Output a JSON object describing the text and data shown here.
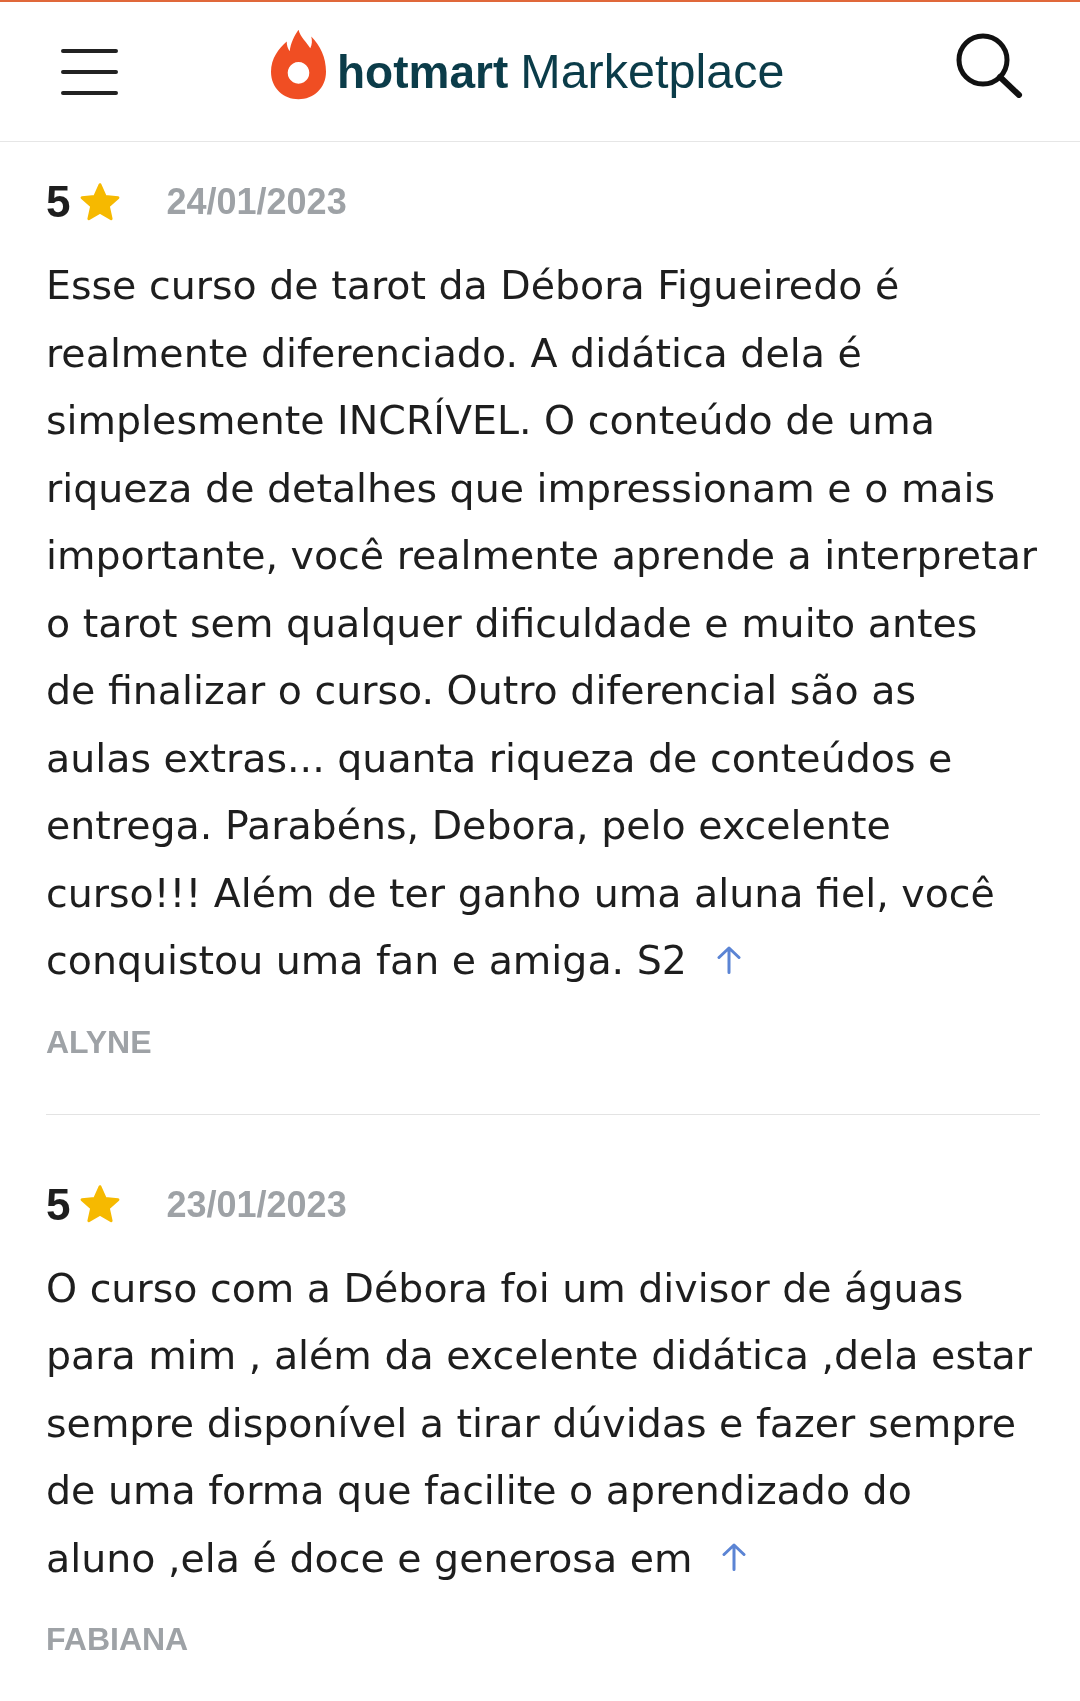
{
  "header": {
    "brand": "hotmart",
    "product": "Marketplace"
  },
  "reviews": [
    {
      "rating": "5",
      "date": "24/01/2023",
      "text": "Esse curso de tarot da Débora Figueiredo é\nrealmente diferenciado. A didática dela é\nsimplesmente INCRÍVEL. O conteúdo de uma\nriqueza de detalhes que impressionam e o mais\nimportante, você realmente aprende a interpretar\no tarot sem qualquer dificuldade e muito antes\nde finalizar o curso. Outro diferencial são as\naulas extras... quanta riqueza de conteúdos e\nentrega. Parabéns, Debora, pelo excelente\ncurso!!! Além de ter ganho uma aluna fiel, você\nconquistou uma fan e amiga. S2",
      "author": "ALYNE"
    },
    {
      "rating": "5",
      "date": "23/01/2023",
      "text": "O curso com a Débora foi um divisor de águas\npara mim , além da excelente didática ,dela estar\nsempre disponível a tirar dúvidas e fazer sempre\nde uma forma que facilite o aprendizado do\naluno ,ela é doce e generosa em",
      "author": "FABIANA"
    }
  ]
}
